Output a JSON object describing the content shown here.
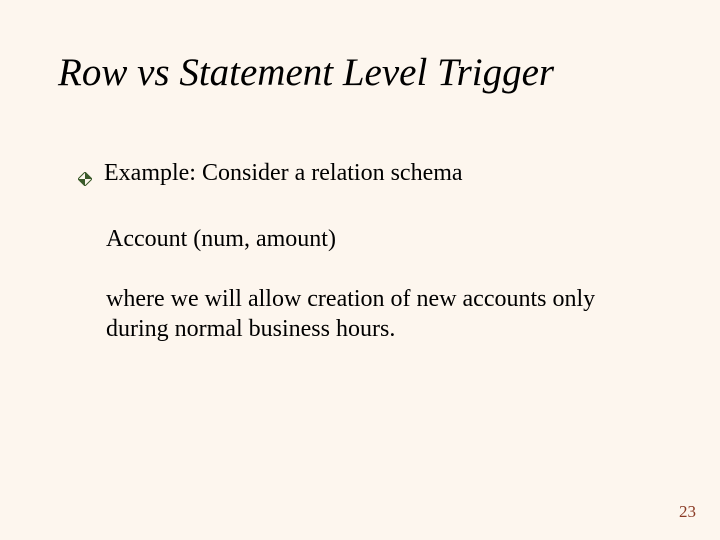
{
  "title": "Row vs Statement Level Trigger",
  "bullet": {
    "line1": "Example: Consider a relation schema",
    "line2": "Account (num, amount)",
    "line3": "where we will allow creation of new accounts only during normal business hours."
  },
  "pageNumber": "23",
  "colors": {
    "bullet": "#3a5a2a",
    "pageNumber": "#8a3a24"
  }
}
